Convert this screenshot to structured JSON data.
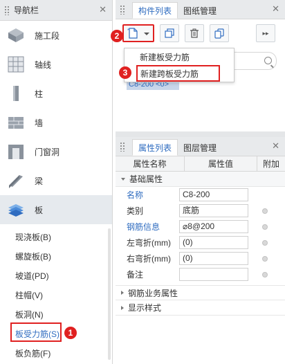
{
  "nav": {
    "title": "导航栏",
    "items": [
      {
        "label": "施工段",
        "icon": "construction-segment-icon"
      },
      {
        "label": "轴线",
        "icon": "grid-axis-icon"
      },
      {
        "label": "柱",
        "icon": "column-icon"
      },
      {
        "label": "墙",
        "icon": "wall-icon"
      },
      {
        "label": "门窗洞",
        "icon": "door-window-icon"
      },
      {
        "label": "梁",
        "icon": "beam-icon"
      },
      {
        "label": "板",
        "icon": "slab-icon"
      }
    ],
    "sub_items": [
      "现浇板(B)",
      "螺旋板(B)",
      "坡道(PD)",
      "柱帽(V)",
      "板洞(N)",
      "板受力筋(S)",
      "板负筋(F)"
    ],
    "selected_sub": "板受力筋(S)"
  },
  "component_panel": {
    "tabs": [
      "构件列表",
      "图纸管理"
    ],
    "active_tab": "构件列表",
    "dropdown": [
      "新建板受力筋",
      "新建跨板受力筋"
    ],
    "chip": "C8-200 <0>"
  },
  "property_panel": {
    "tabs": [
      "属性列表",
      "图层管理"
    ],
    "active_tab": "属性列表",
    "columns": [
      "属性名称",
      "属性值",
      "附加"
    ],
    "section_basic": "基础属性",
    "rows": [
      {
        "name": "名称",
        "value": "C8-200",
        "link": true,
        "dot": false
      },
      {
        "name": "类别",
        "value": "底筋",
        "link": false,
        "dot": true
      },
      {
        "name": "钢筋信息",
        "value": "⌀8@200",
        "link": true,
        "dot": true
      },
      {
        "name": "左弯折(mm)",
        "value": "(0)",
        "link": false,
        "dot": true
      },
      {
        "name": "右弯折(mm)",
        "value": "(0)",
        "link": false,
        "dot": true
      },
      {
        "name": "备注",
        "value": "",
        "link": false,
        "dot": true
      }
    ],
    "section_business": "钢筋业务属性",
    "section_display": "显示样式"
  },
  "callouts": [
    "1",
    "2",
    "3"
  ]
}
